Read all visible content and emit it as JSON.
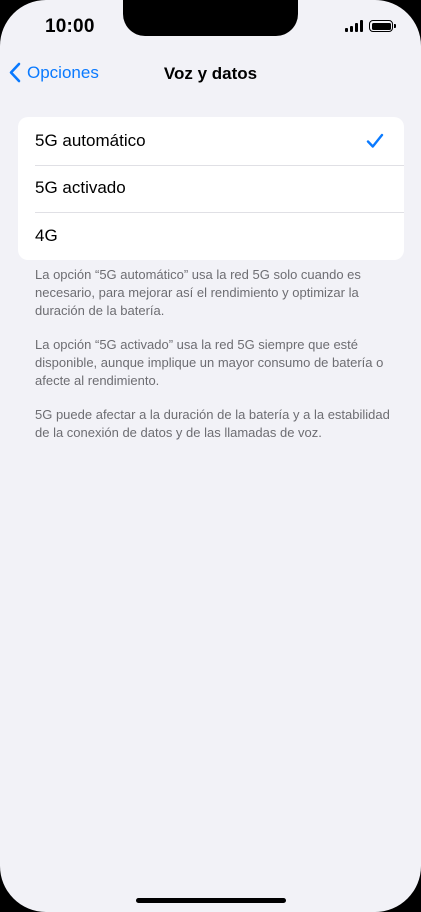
{
  "status_bar": {
    "time": "10:00"
  },
  "nav": {
    "back_label": "Opciones",
    "title": "Voz y datos"
  },
  "options": [
    {
      "label": "5G automático",
      "selected": true
    },
    {
      "label": "5G activado",
      "selected": false
    },
    {
      "label": "4G",
      "selected": false
    }
  ],
  "notes": [
    "La opción “5G automático” usa la red 5G solo cuando es necesario, para mejorar así el rendimiento y optimizar la duración de la batería.",
    "La opción “5G activado” usa la red 5G siempre que esté disponible, aunque implique un mayor consumo de batería o afecte al rendimiento.",
    "5G puede afectar a la duración de la batería y a la estabilidad de la conexión de datos y de las llamadas de voz."
  ],
  "colors": {
    "accent": "#0a7aff",
    "background": "#f2f2f7",
    "secondary_text": "#6d6d72"
  },
  "icons": {
    "back": "chevron-left-icon",
    "selected": "checkmark-icon",
    "signal": "cellular-signal-icon",
    "battery": "battery-icon"
  }
}
